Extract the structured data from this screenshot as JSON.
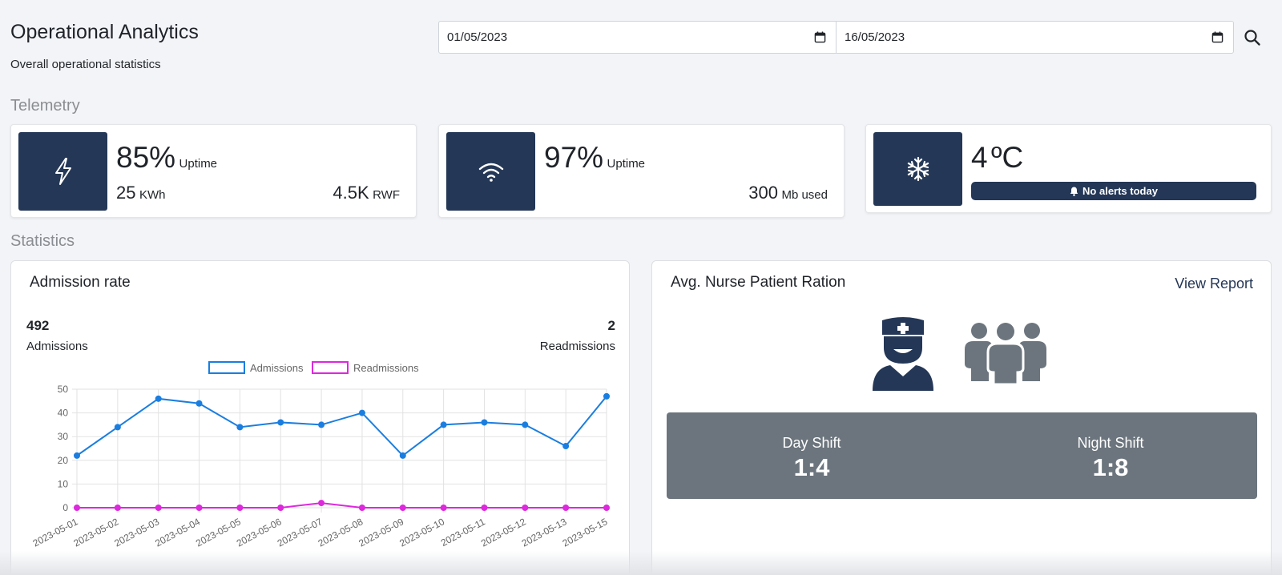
{
  "header": {
    "title": "Operational Analytics",
    "subtitle": "Overall operational statistics",
    "date_from": "01/05/2023",
    "date_to": "16/05/2023"
  },
  "sections": {
    "telemetry": "Telemetry",
    "statistics": "Statistics"
  },
  "telemetry": {
    "power": {
      "uptime_value": "85%",
      "uptime_label": "Uptime",
      "energy_value": "25",
      "energy_unit": "KWh",
      "cost_value": "4.5K",
      "cost_unit": "RWF"
    },
    "network": {
      "uptime_value": "97%",
      "uptime_label": "Uptime",
      "data_value": "300",
      "data_unit": "Mb used"
    },
    "fridge": {
      "temp_value": "4",
      "temp_unit": "ºC",
      "alert_text": "No alerts today"
    }
  },
  "admission": {
    "title": "Admission rate",
    "admissions_value": "492",
    "admissions_label": "Admissions",
    "readmissions_value": "2",
    "readmissions_label": "Readmissions"
  },
  "nurse_ratio": {
    "title": "Avg. Nurse Patient Ration",
    "view_report": "View Report",
    "day_label": "Day Shift",
    "day_value": "1:4",
    "night_label": "Night Shift",
    "night_value": "1:8"
  },
  "colors": {
    "navy": "#243756",
    "admissions": "#1a7ee0",
    "readmissions": "#dd28dd",
    "ratio_panel": "#6c757d"
  },
  "icons": {
    "power": "lightning-icon",
    "network": "wifi-icon",
    "fridge": "snowflake-icon",
    "alert": "bell-icon",
    "search": "search-icon",
    "calendar": "calendar-icon",
    "nurse": "nurse-icon",
    "patients": "patients-icon"
  },
  "chart_data": {
    "type": "line",
    "categories": [
      "2023-05-01",
      "2023-05-02",
      "2023-05-03",
      "2023-05-04",
      "2023-05-05",
      "2023-05-06",
      "2023-05-07",
      "2023-05-08",
      "2023-05-09",
      "2023-05-10",
      "2023-05-11",
      "2023-05-12",
      "2023-05-13",
      "2023-05-15"
    ],
    "series": [
      {
        "name": "Admissions",
        "values": [
          22,
          34,
          46,
          44,
          34,
          36,
          35,
          40,
          22,
          35,
          36,
          35,
          26,
          47
        ]
      },
      {
        "name": "Readmissions",
        "values": [
          0,
          0,
          0,
          0,
          0,
          0,
          2,
          0,
          0,
          0,
          0,
          0,
          0,
          0
        ]
      }
    ],
    "ylim": [
      0,
      50
    ],
    "yticks": [
      0,
      10,
      20,
      30,
      40,
      50
    ],
    "grid": true,
    "legend": "top-center"
  }
}
